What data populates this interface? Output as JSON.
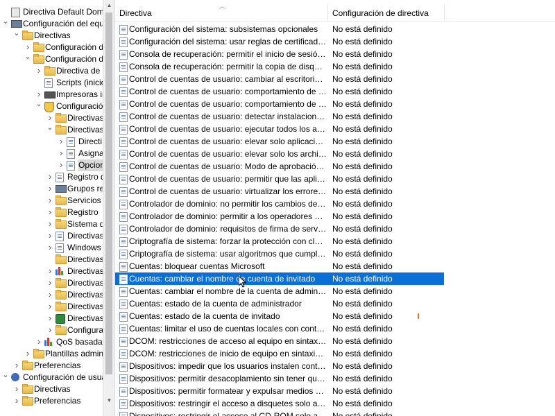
{
  "tree": {
    "items": [
      {
        "label": "Directiva Default Domain Po",
        "level": 0,
        "caret": "",
        "icon": "policy-icon",
        "selected": false
      },
      {
        "label": "Configuración del equipo",
        "level": 0,
        "caret": "open",
        "icon": "computer-icon",
        "selected": false
      },
      {
        "label": "Directivas",
        "level": 1,
        "caret": "open",
        "icon": "folder-icon",
        "selected": false
      },
      {
        "label": "Configuración de",
        "level": 2,
        "caret": "closed",
        "icon": "folder-icon",
        "selected": false
      },
      {
        "label": "Configuración de",
        "level": 2,
        "caret": "open",
        "icon": "folder-icon",
        "selected": false
      },
      {
        "label": "Directiva de re",
        "level": 3,
        "caret": "closed",
        "icon": "folder-icon",
        "selected": false
      },
      {
        "label": "Scripts (inicio",
        "level": 3,
        "caret": "",
        "icon": "document-icon",
        "selected": false
      },
      {
        "label": "Impresoras im",
        "level": 3,
        "caret": "closed",
        "icon": "printer-icon",
        "selected": false
      },
      {
        "label": "Configuración",
        "level": 3,
        "caret": "open",
        "icon": "security-icon",
        "selected": false
      },
      {
        "label": "Directivas",
        "level": 4,
        "caret": "closed",
        "icon": "folder-icon",
        "selected": false
      },
      {
        "label": "Directivas",
        "level": 4,
        "caret": "open",
        "icon": "folder-icon",
        "selected": false
      },
      {
        "label": "Directi",
        "level": 5,
        "caret": "closed",
        "icon": "document-icon",
        "selected": false
      },
      {
        "label": "Asigna",
        "level": 5,
        "caret": "closed",
        "icon": "document-icon",
        "selected": false
      },
      {
        "label": "Opcion",
        "level": 5,
        "caret": "closed",
        "icon": "document-icon",
        "selected": true
      },
      {
        "label": "Registro d",
        "level": 4,
        "caret": "closed",
        "icon": "document-icon",
        "selected": false
      },
      {
        "label": "Grupos res",
        "level": 4,
        "caret": "closed",
        "icon": "users-icon",
        "selected": false
      },
      {
        "label": "Servicios c",
        "level": 4,
        "caret": "closed",
        "icon": "folder-icon",
        "selected": false
      },
      {
        "label": "Registro",
        "level": 4,
        "caret": "closed",
        "icon": "folder-icon",
        "selected": false
      },
      {
        "label": "Sistema de",
        "level": 4,
        "caret": "closed",
        "icon": "folder-icon",
        "selected": false
      },
      {
        "label": "Directivas",
        "level": 4,
        "caret": "closed",
        "icon": "document-icon",
        "selected": false
      },
      {
        "label": "Windows I",
        "level": 4,
        "caret": "closed",
        "icon": "document-icon",
        "selected": false
      },
      {
        "label": "Directivas",
        "level": 4,
        "caret": "",
        "icon": "folder-icon",
        "selected": false
      },
      {
        "label": "Directivas",
        "level": 4,
        "caret": "closed",
        "icon": "chart-icon",
        "selected": false
      },
      {
        "label": "Directivas",
        "level": 4,
        "caret": "closed",
        "icon": "folder-icon",
        "selected": false
      },
      {
        "label": "Directivas",
        "level": 4,
        "caret": "closed",
        "icon": "folder-icon",
        "selected": false
      },
      {
        "label": "Directivas",
        "level": 4,
        "caret": "closed",
        "icon": "folder-icon",
        "selected": false
      },
      {
        "label": "Directivas",
        "level": 4,
        "caret": "closed",
        "icon": "green-shield-icon",
        "selected": false
      },
      {
        "label": "Configura",
        "level": 4,
        "caret": "closed",
        "icon": "folder-icon",
        "selected": false
      },
      {
        "label": "QoS basada e",
        "level": 3,
        "caret": "closed",
        "icon": "chart-icon",
        "selected": false
      },
      {
        "label": "Plantillas adminis",
        "level": 2,
        "caret": "closed",
        "icon": "folder-icon",
        "selected": false
      },
      {
        "label": "Preferencias",
        "level": 1,
        "caret": "closed",
        "icon": "folder-icon",
        "selected": false
      },
      {
        "label": "Configuración de usuario",
        "level": 0,
        "caret": "open",
        "icon": "user-icon",
        "selected": false
      },
      {
        "label": "Directivas",
        "level": 1,
        "caret": "closed",
        "icon": "folder-icon",
        "selected": false
      },
      {
        "label": "Preferencias",
        "level": 1,
        "caret": "closed",
        "icon": "folder-icon",
        "selected": false
      }
    ]
  },
  "list": {
    "columns": [
      "Directiva",
      "Configuración de directiva"
    ],
    "rows": [
      {
        "name": "Configuración del sistema: subsistemas opcionales",
        "value": "No está definido"
      },
      {
        "name": "Configuración del sistema: usar reglas de certificado en ejec...",
        "value": "No está definido"
      },
      {
        "name": "Consola de recuperación: permitir el inicio de sesión admini...",
        "value": "No está definido"
      },
      {
        "name": "Consola de recuperación: permitir la copia de disquetes y el ...",
        "value": "No está definido"
      },
      {
        "name": "Control de cuentas de usuario: cambiar al escritorio seguro ...",
        "value": "No está definido"
      },
      {
        "name": "Control de cuentas de usuario: comportamiento de la petici...",
        "value": "No está definido"
      },
      {
        "name": "Control de cuentas de usuario: comportamiento de la petici...",
        "value": "No está definido"
      },
      {
        "name": "Control de cuentas de usuario: detectar instalaciones de apli...",
        "value": "No está definido"
      },
      {
        "name": "Control de cuentas de usuario: ejecutar todos los administra...",
        "value": "No está definido"
      },
      {
        "name": "Control de cuentas de usuario: elevar solo aplicaciones UIAc...",
        "value": "No está definido"
      },
      {
        "name": "Control de cuentas de usuario: elevar solo los archivos ejecu...",
        "value": "No está definido"
      },
      {
        "name": "Control de cuentas de usuario: Modo de aprobación de ad...",
        "value": "No está definido"
      },
      {
        "name": "Control de cuentas de usuario: permitir que las aplicaciones ...",
        "value": "No está definido"
      },
      {
        "name": "Control de cuentas de usuario: virtualizar los errores de escri...",
        "value": "No está definido"
      },
      {
        "name": "Controlador de dominio: no permitir los cambios de contras...",
        "value": "No está definido"
      },
      {
        "name": "Controlador de dominio: permitir a los operadores de servid...",
        "value": "No está definido"
      },
      {
        "name": "Controlador de dominio: requisitos de firma de servidor LDAP",
        "value": "No está definido"
      },
      {
        "name": "Criptografía de sistema: forzar la protección con claves seg...",
        "value": "No está definido"
      },
      {
        "name": "Criptografía de sistema: usar algoritmos que cumplan FIPS ...",
        "value": "No está definido"
      },
      {
        "name": "Cuentas: bloquear cuentas Microsoft",
        "value": "No está definido"
      },
      {
        "name": "Cuentas: cambiar el nombre de cuenta de invitado",
        "value": "No está definido",
        "selected": true
      },
      {
        "name": "Cuentas: cambiar el nombre de la cuenta de administrador",
        "value": "No está definido"
      },
      {
        "name": "Cuentas: estado de la cuenta de administrador",
        "value": "No está definido"
      },
      {
        "name": "Cuentas: estado de la cuenta de invitado",
        "value": "No está definido"
      },
      {
        "name": "Cuentas: limitar el uso de cuentas locales con contraseña en...",
        "value": "No está definido"
      },
      {
        "name": "DCOM: restricciones de acceso al equipo en sintaxis de Leng...",
        "value": "No está definido"
      },
      {
        "name": "DCOM: restricciones de inicio de equipo en sintaxis de Leng...",
        "value": "No está definido"
      },
      {
        "name": "Dispositivos: impedir que los usuarios instalen controladore...",
        "value": "No está definido"
      },
      {
        "name": "Dispositivos: permitir desacoplamiento sin tener que iniciar ...",
        "value": "No está definido"
      },
      {
        "name": "Dispositivos: permitir formatear y expulsar medios extraíbles",
        "value": "No está definido"
      },
      {
        "name": "Dispositivos: restringir el acceso a disquetes solo al usuario c...",
        "value": "No está definido"
      },
      {
        "name": "Dispositivos: restringir el acceso al CD-ROM solo al usuario ...",
        "value": "No está definido"
      }
    ]
  },
  "colors": {
    "selection": "#0a6fd6",
    "tree_selection": "#d9d9d9"
  }
}
